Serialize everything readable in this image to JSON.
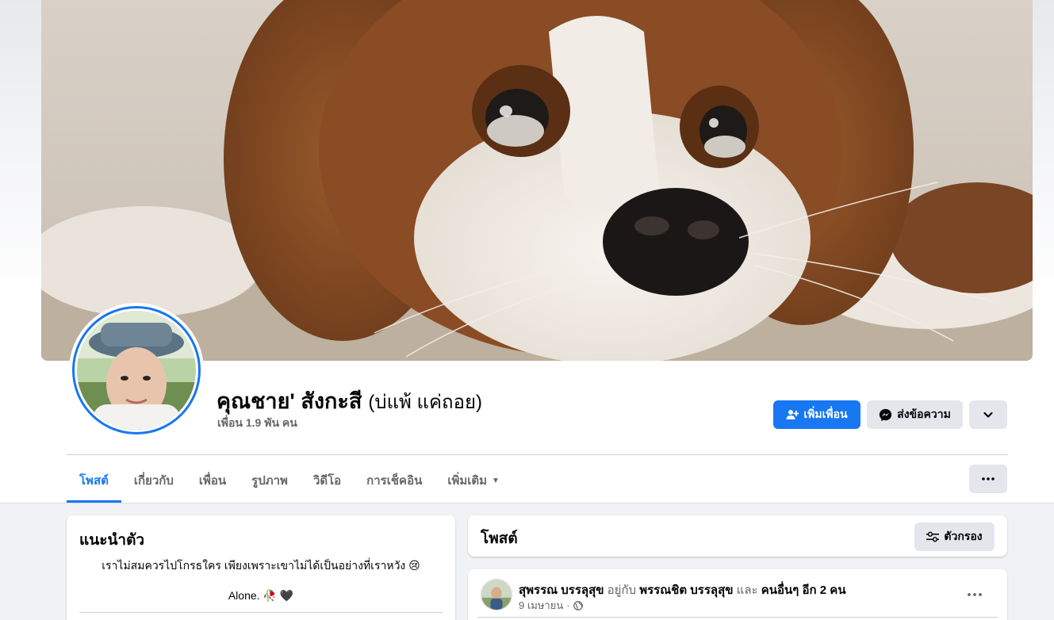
{
  "profile": {
    "name": "คุณชาย' สังกะสี",
    "alternate_name": "(บ่แพ้ แค่ถอย)",
    "friends_count": "เพื่อน 1.9 พัน คน"
  },
  "actions": {
    "add_friend": "เพิ่มเพื่อน",
    "message": "ส่งข้อความ"
  },
  "tabs": [
    {
      "label": "โพสต์",
      "active": true
    },
    {
      "label": "เกี่ยวกับ"
    },
    {
      "label": "เพื่อน"
    },
    {
      "label": "รูปภาพ"
    },
    {
      "label": "วิดีโอ"
    },
    {
      "label": "การเช็คอิน"
    },
    {
      "label": "เพิ่มเติม"
    }
  ],
  "intro": {
    "title": "แนะนำตัว",
    "bio": "เราไม่สมควรไปโกรธใคร เพียงเพราะเขาไม่ได้เป็นอย่างที่เราหวัง 😢",
    "alone": "Alone. 🥀 🖤"
  },
  "posts_section": {
    "title": "โพสต์",
    "filter_label": "ตัวกรอง"
  },
  "post": {
    "author": "สุพรรณ บรรลุสุข",
    "with_text": "อยู่กับ",
    "tagged": "พรรณชิต บรรลุสุข",
    "and_text": "และ",
    "others": "คนอื่นๆ อีก 2 คน",
    "date": "9 เมษายน",
    "dot": "·"
  },
  "colors": {
    "accent": "#1877f2",
    "background": "#f0f2f5",
    "muted_text": "#65676b",
    "secondary_button": "#e4e6eb"
  },
  "icons": [
    "add-friend-icon",
    "messenger-icon",
    "chevron-down-icon",
    "more-dots-icon",
    "filter-icon",
    "globe-icon",
    "caret-down-icon"
  ]
}
